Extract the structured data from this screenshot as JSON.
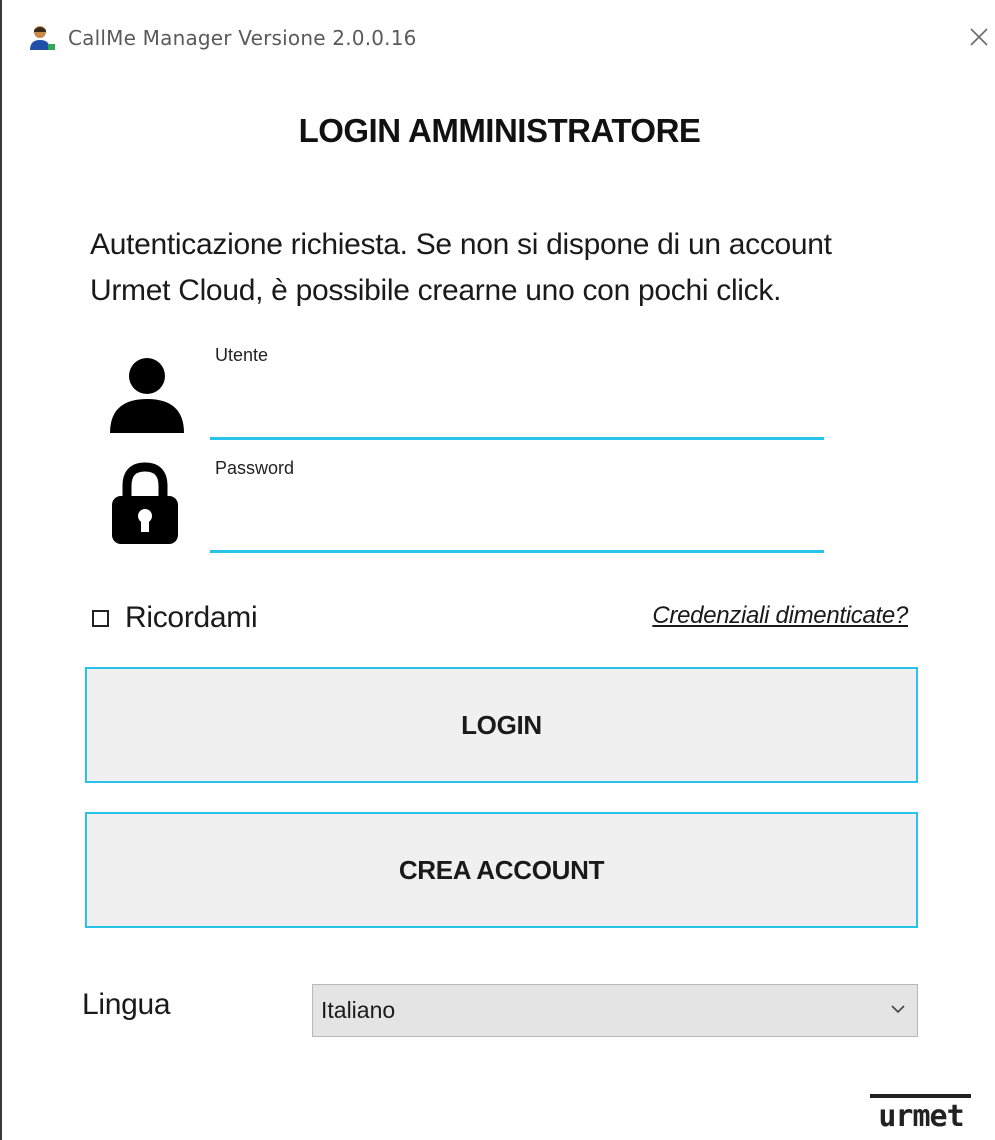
{
  "window": {
    "title": "CallMe Manager Versione 2.0.0.16",
    "app_icon": "user-manager-icon",
    "close_icon": "close-icon"
  },
  "heading": "LOGIN AMMINISTRATORE",
  "intro": {
    "line1": "Autenticazione richiesta. Se non si dispone di un account",
    "line2": "Urmet Cloud, è possibile crearne uno con pochi click."
  },
  "fields": {
    "user": {
      "label": "Utente",
      "value": "",
      "icon": "user-icon"
    },
    "password": {
      "label": "Password",
      "value": "",
      "icon": "lock-icon"
    }
  },
  "remember": {
    "label": "Ricordami",
    "checked": false
  },
  "forgot_link": "Credenziali dimenticate?",
  "buttons": {
    "login": "LOGIN",
    "create_account": "CREA ACCOUNT"
  },
  "language": {
    "label": "Lingua",
    "selected": "Italiano"
  },
  "logo": "urmet",
  "colors": {
    "accent": "#27c3e8",
    "button_bg": "#f0f0f0",
    "select_bg": "#e4e4e4"
  }
}
